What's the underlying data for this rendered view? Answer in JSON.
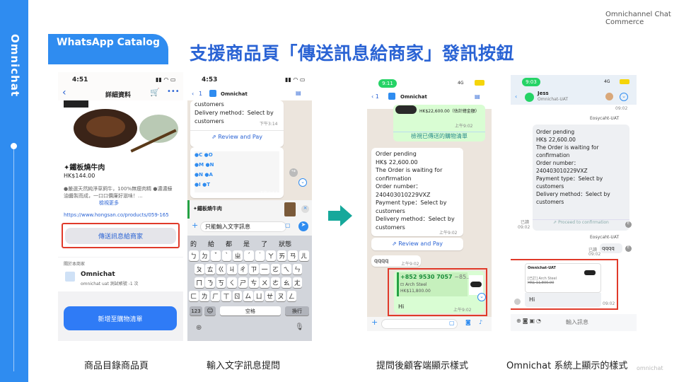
{
  "sidebar": {
    "brand": "Omnichat"
  },
  "header": {
    "badge": "WhatsApp Catalog",
    "title": "支援商品頁「傳送訊息給商家」發訊按鈕",
    "corner": "Omnichannel Chat Commerce"
  },
  "watermark": "omnichat",
  "colors": {
    "accent": "#2f8cf0",
    "title": "#2a63d4",
    "highlight": "#e03a2a",
    "wa_green": "#d9fdd3"
  },
  "phone1": {
    "time": "4:51",
    "nav_title": "詳細資料",
    "product_name": "✦鐵板燒牛肉",
    "price": "HK$144.00",
    "desc": "●嚴選天然純淨草飼牛，100%無瘦肉精 ●濃濃蠔油醬製而成，一口口價廉好滋味！...",
    "more": "檢視更多",
    "url": "https://www.hongsan.co/products/059-165",
    "message_button": "傳送訊息給商家",
    "about_label": "關於本商家",
    "merchant": "Omnichat",
    "merchant_sub": "omnichat uat 測試帳號 -1 次",
    "add_cart": "新增至購物清單",
    "caption": "商品目錄商品頁"
  },
  "phone2": {
    "time": "4:53",
    "back": "1",
    "chat_name": "Omnichat",
    "msg_lines": [
      "customers",
      "Delivery method：Select by",
      "customers"
    ],
    "msg_time": "下午3:14",
    "review": "Review and Pay",
    "img_time": "下午3:14",
    "reply_title": "✦鐵板燒牛肉",
    "input_text": "只能輸入文字訊息",
    "suggest": [
      "的",
      "給",
      "都",
      "是",
      "了",
      "狀態"
    ],
    "row1": [
      "ㄅ",
      "ㄉ",
      "ˇ",
      "ˋ",
      "ㄓ",
      "ˊ",
      "˙",
      "ㄚ",
      "ㄞ",
      "ㄢ",
      "ㄦ"
    ],
    "row2": [
      "ㄆ",
      "ㄊ",
      "ㄍ",
      "ㄐ",
      "ㄔ",
      "ㄗ",
      "一",
      "ㄛ",
      "ㄟ",
      "ㄣ"
    ],
    "row3": [
      "ㄇ",
      "ㄋ",
      "ㄎ",
      "ㄑ",
      "ㄕ",
      "ㄘ",
      "ㄨ",
      "ㄜ",
      "ㄠ",
      "ㄤ"
    ],
    "row4": [
      "ㄈ",
      "ㄌ",
      "ㄏ",
      "ㄒ",
      "ㄖ",
      "ㄙ",
      "ㄩ",
      "ㄝ",
      "ㄡ",
      "ㄥ"
    ],
    "num_key": "123",
    "space": "空格",
    "enter": "換行",
    "caption": "輸入文字訊息提問"
  },
  "phone3": {
    "time": "9:11",
    "network": "4G",
    "back": "1",
    "chat_name": "Omnichat",
    "top_price": "HK$22,600.00（估計總金額）",
    "top_time": "上午9:02",
    "view_cart": "檢視已傳送的購物清單",
    "order_lines": [
      "Order pending",
      "HK$ 22,600.00",
      "The Order is waiting for",
      "confirmation",
      "Order number：",
      "240403010229VXZ",
      "Payment type：Select by",
      "customers",
      "Delivery method：Select by",
      "customers"
    ],
    "order_time": "上午9:02",
    "review": "Review and Pay",
    "qqqq": "qqqq",
    "qqqq_time": "上午9:02",
    "phone": "+852 9530 7057",
    "phone_suffix": "~85...",
    "product": "Arch Steel",
    "product_price": "HK$11,800.00",
    "hi": "Hi",
    "hi_time": "上午9:02",
    "caption": "提問後顧客端顯示樣式"
  },
  "phone4": {
    "time": "9:03",
    "network": "4G",
    "contact": "Jess",
    "contact_sub": "Omnichat-UAT",
    "t1": "09:02",
    "order_label": "Eosycaht-UAT",
    "order_lines": [
      "Order pending",
      "HK$ 22,600.00",
      "The Order is waiting for",
      "confirmation",
      "Order number：",
      "240403010229VXZ",
      "Payment type：Select by",
      "customers",
      "Delivery method：Select by",
      "customers"
    ],
    "proceed": "Proceed to confirmation",
    "read1": "已讀",
    "t2": "09:02",
    "sender2": "Eosycaht-UAT",
    "read2": "已讀",
    "qqqq": "qqqq",
    "t3": "09:02",
    "card_title": "Omnichat-UAT",
    "card_tag": "[已訂]",
    "card_product": "Arch Steel",
    "card_price": "HK$ 11,800.00",
    "hi": "Hi",
    "t4": "09:02",
    "input_ph": "輸入訊息",
    "caption": "Omnichat 系統上顯示的樣式"
  }
}
